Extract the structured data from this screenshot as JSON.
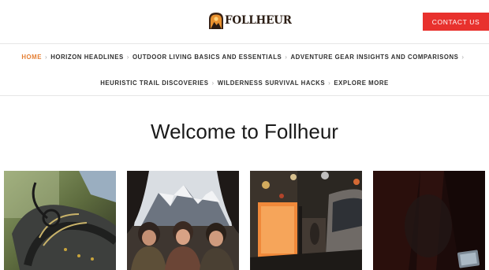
{
  "header": {
    "logo_text": "FOLLHEUR",
    "contact_label": "CONTACT US"
  },
  "nav": {
    "row1": [
      {
        "label": "HOME",
        "active": true
      },
      {
        "label": "HORIZON HEADLINES"
      },
      {
        "label": "OUTDOOR LIVING BASICS AND ESSENTIALS"
      },
      {
        "label": "ADVENTURE GEAR INSIGHTS AND COMPARISONS"
      }
    ],
    "row2": [
      {
        "label": "HEURISTIC TRAIL DISCOVERIES"
      },
      {
        "label": "WILDERNESS SURVIVAL HACKS"
      },
      {
        "label": "EXPLORE MORE"
      }
    ],
    "separator": "›"
  },
  "main": {
    "title": "Welcome to Follheur"
  },
  "colors": {
    "accent": "#e8312d",
    "active_nav": "#e57f33",
    "text": "#1a1a1a"
  },
  "cards": [
    {
      "icon": "hiking-boot-photo"
    },
    {
      "icon": "mountain-campers-photo"
    },
    {
      "icon": "city-night-street-photo"
    },
    {
      "icon": "dark-tent-interior-photo"
    }
  ]
}
